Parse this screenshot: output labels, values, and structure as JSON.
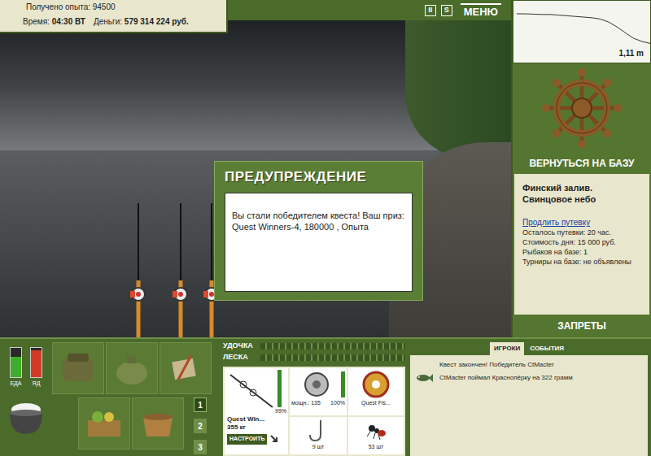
{
  "stats": {
    "experience": "Получено опыта: 94500",
    "time_label": "Время:",
    "time": "04:30 ВТ",
    "money_label": "Деньги:",
    "money": "579 314 224 руб."
  },
  "top_buttons": [
    "II",
    "S"
  ],
  "menu": "МЕНЮ",
  "depth": {
    "reading": "1,11 m",
    "values": [
      0.2,
      0.2,
      0.21,
      0.22,
      0.22,
      0.24,
      0.26,
      0.28,
      0.3,
      0.32,
      0.36,
      0.45,
      0.6,
      0.78,
      0.95,
      1.05,
      1.11
    ]
  },
  "dialog": {
    "title": "ПРЕДУПРЕЖДЕНИЕ",
    "message": "Вы стали победителем квеста! Ваш приз: Quest Winners-4, 180000 , Опыта"
  },
  "base": {
    "button": "ВЕРНУТЬСЯ НА БАЗУ",
    "location": "Финский залив.",
    "weather": "Свинцовое небо",
    "link": "Продлить путевку",
    "details": [
      "Осталось путевки: 20 час.",
      "Стоимость дня: 15 000 руб.",
      "Рыбаков на базе: 1",
      "Турниры на базе: не объявлены"
    ],
    "bans": "ЗАПРЕТЫ"
  },
  "meters": [
    {
      "label": "ЕДА",
      "level": 0.7,
      "color": "#3fae2e"
    },
    {
      "label": "ЯД",
      "level": 0.92,
      "color": "#d23a26"
    }
  ],
  "slots": [
    {
      "label": "1",
      "selected": true
    },
    {
      "label": "2",
      "selected": false
    },
    {
      "label": "3",
      "selected": false
    }
  ],
  "tension": [
    {
      "label": "УДОЧКА",
      "level": 0
    },
    {
      "label": "ЛЕСКА",
      "level": 0
    }
  ],
  "tackle": {
    "rod": {
      "name": "Quest Win...",
      "weight": "355 кг",
      "condition": "99%",
      "level": 0.99,
      "button": "НАСТРОИТЬ"
    },
    "reel": {
      "power": "мощн.: 135",
      "condition": "100%",
      "level": 1
    },
    "line": {
      "name": "Quest Fis..."
    },
    "hook": {
      "count": "9 шт"
    },
    "bait": {
      "count": "53 шт"
    }
  },
  "chat": {
    "tabs": [
      {
        "label": "ИГРОКИ",
        "selected": true
      },
      {
        "label": "СОБЫТИЯ",
        "selected": false
      }
    ],
    "messages": [
      {
        "kind": "system",
        "text": "Квест закончен! Победитель CtMacter"
      },
      {
        "kind": "catch",
        "text": "CtMacter поймал Краснопёрку на 322 грамм"
      }
    ]
  }
}
